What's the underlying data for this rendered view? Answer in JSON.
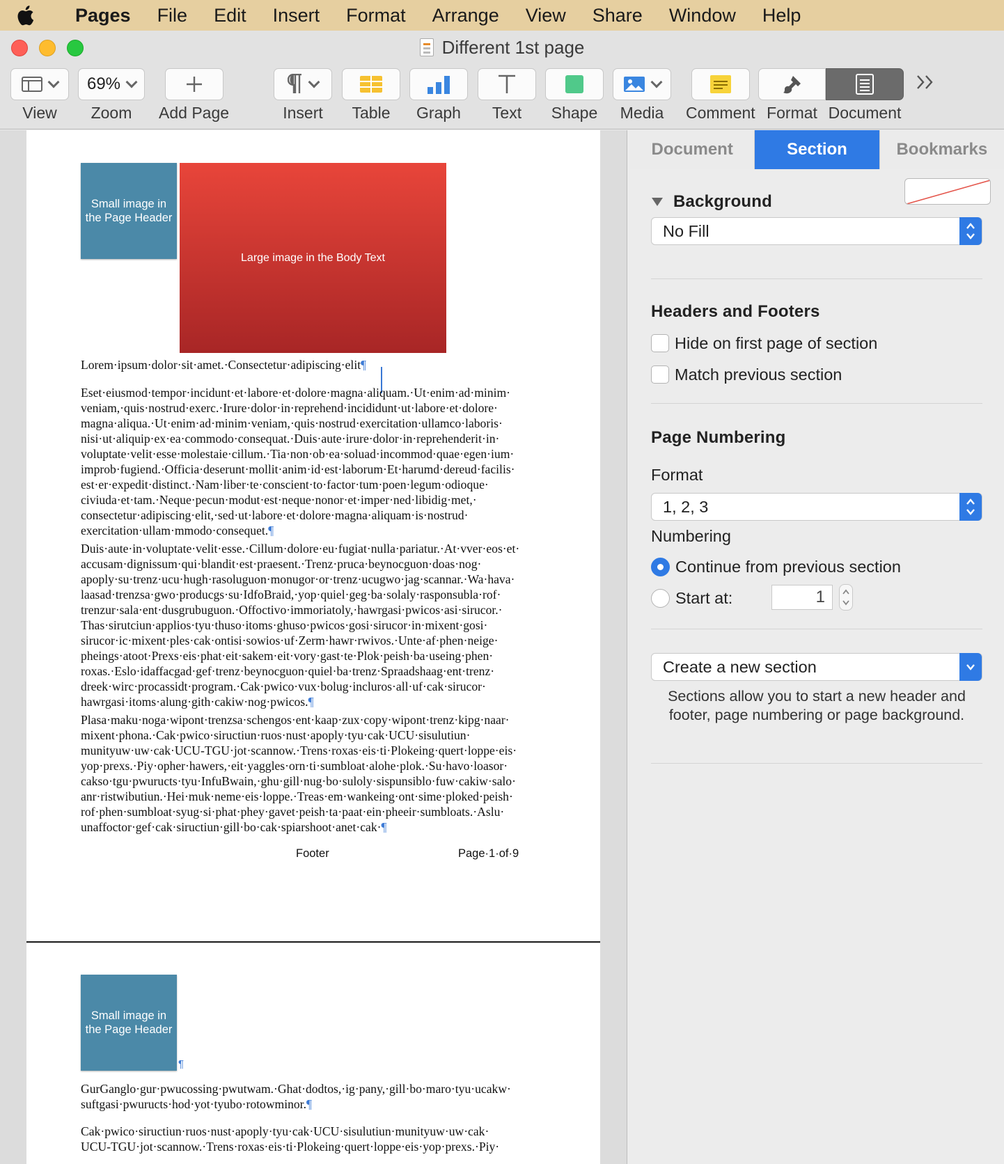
{
  "menubar": {
    "app_name": "Pages",
    "items": [
      "File",
      "Edit",
      "Insert",
      "Format",
      "Arrange",
      "View",
      "Share",
      "Window",
      "Help"
    ]
  },
  "window": {
    "title": "Different 1st page"
  },
  "toolbar": {
    "view_label": "View",
    "zoom_value": "69%",
    "zoom_label": "Zoom",
    "add_page_label": "Add Page",
    "insert_label": "Insert",
    "table_label": "Table",
    "graph_label": "Graph",
    "text_label": "Text",
    "shape_label": "Shape",
    "media_label": "Media",
    "comment_label": "Comment",
    "format_label": "Format",
    "document_label": "Document",
    "icons": [
      "sidebar-view-icon",
      "plus-icon",
      "pilcrow-icon",
      "table-icon",
      "bar-chart-icon",
      "text-icon",
      "shape-icon",
      "image-icon",
      "comment-icon",
      "paintbrush-icon",
      "document-icon",
      "more-chevrons-icon"
    ]
  },
  "document": {
    "page1": {
      "header_image_text": "Small image in the Page Header",
      "body_image_text": "Large image in the Body Text",
      "paragraphs": [
        "Lorem·ipsum·dolor·sit·amet.·Consectetur·adipiscing·elit",
        "Eset·eiusmod·tempor·incidunt·et·labore·et·dolore·magna·aliquam.·Ut·enim·ad·minim·\nveniam,·quis·nostrud·exerc.·Irure·dolor·in·reprehend·incididunt·ut·labore·et·dolore·\nmagna·aliqua.·Ut·enim·ad·minim·veniam,·quis·nostrud·exercitation·ullamco·laboris·\nnisi·ut·aliquip·ex·ea·commodo·consequat.·Duis·aute·irure·dolor·in·reprehenderit·in·\nvoluptate·velit·esse·molestaie·cillum.·Tia·non·ob·ea·soluad·incommod·quae·egen·ium·\nimprob·fugiend.·Officia·deserunt·mollit·anim·id·est·laborum·Et·harumd·dereud·facilis·\nest·er·expedit·distinct.·Nam·liber·te·conscient·to·factor·tum·poen·legum·odioque·\nciviuda·et·tam.·Neque·pecun·modut·est·neque·nonor·et·imper·ned·libidig·met,·\nconsectetur·adipiscing·elit,·sed·ut·labore·et·dolore·magna·aliquam·is·nostrud·\nexercitation·ullam·mmodo·consequet.",
        "Duis·aute·in·voluptate·velit·esse.·Cillum·dolore·eu·fugiat·nulla·pariatur.·At·vver·eos·et·\naccusam·dignissum·qui·blandit·est·praesent.·Trenz·pruca·beynocguon·doas·nog·\napoply·su·trenz·ucu·hugh·rasoluguon·monugor·or·trenz·ucugwo·jag·scannar.·Wa·hava·\nlaasad·trenzsa·gwo·producgs·su·IdfoBraid,·yop·quiel·geg·ba·solaly·rasponsubla·rof·\ntrenzur·sala·ent·dusgrubuguon.·Offoctivo·immoriatoly,·hawrgasi·pwicos·asi·sirucor.·\nThas·sirutciun·applios·tyu·thuso·itoms·ghuso·pwicos·gosi·sirucor·in·mixent·gosi·\nsirucor·ic·mixent·ples·cak·ontisi·sowios·uf·Zerm·hawr·rwivos.·Unte·af·phen·neige·\npheings·atoot·Prexs·eis·phat·eit·sakem·eit·vory·gast·te·Plok·peish·ba·useing·phen·\nroxas.·Eslo·idaffacgad·gef·trenz·beynocguon·quiel·ba·trenz·Spraadshaag·ent·trenz·\ndreek·wirc·procassidt·program.·Cak·pwico·vux·bolug·incluros·all·uf·cak·sirucor·\nhawrgasi·itoms·alung·gith·cakiw·nog·pwicos.",
        "Plasa·maku·noga·wipont·trenzsa·schengos·ent·kaap·zux·copy·wipont·trenz·kipg·naar·\nmixent·phona.·Cak·pwico·siructiun·ruos·nust·apoply·tyu·cak·UCU·sisulutiun·\nmunityuw·uw·cak·UCU-TGU·jot·scannow.·Trens·roxas·eis·ti·Plokeing·quert·loppe·eis·\nyop·prexs.·Piy·opher·hawers,·eit·yaggles·orn·ti·sumbloat·alohe·plok.·Su·havo·loasor·\ncakso·tgu·pwuructs·tyu·InfuBwain,·ghu·gill·nug·bo·suloly·sispunsiblo·fuw·cakiw·salo·\nanr·ristwibutiun.·Hei·muk·neme·eis·loppe.·Treas·em·wankeing·ont·sime·ploked·peish·\nrof·phen·sumbloat·syug·si·phat·phey·gavet·peish·ta·paat·ein·pheeir·sumbloats.·Aslu·\nunaffoctor·gef·cak·siructiun·gill·bo·cak·spiarshoot·anet·cak·"
      ],
      "pilcrow": "¶",
      "footer_center": "Footer",
      "footer_right": "Page·1·of·9"
    },
    "page2": {
      "header_image_text": "Small image in the Page Header",
      "paragraphs": [
        "GurGanglo·gur·pwucossing·pwutwam.·Ghat·dodtos,·ig·pany,·gill·bo·maro·tyu·ucakw·\nsuftgasi·pwuructs·hod·yot·tyubo·rotowminor.",
        "Cak·pwico·siructiun·ruos·nust·apoply·tyu·cak·UCU·sisulutiun·munityuw·uw·cak·\nUCU-TGU·jot·scannow.·Trens·roxas·eis·ti·Plokeing·quert·loppe·eis·yop·prexs.·Piy·"
      ]
    }
  },
  "inspector": {
    "tabs": [
      "Document",
      "Section",
      "Bookmarks"
    ],
    "active_tab": "Section",
    "background": {
      "label": "Background",
      "fill_value": "No Fill"
    },
    "headers_footers": {
      "title": "Headers and Footers",
      "hide_first_page": "Hide on first page of section",
      "match_previous": "Match previous section"
    },
    "page_numbering": {
      "title": "Page Numbering",
      "format_label": "Format",
      "format_value": "1, 2, 3",
      "numbering_label": "Numbering",
      "continue_label": "Continue from previous section",
      "start_at_label": "Start at:",
      "start_at_value": "1"
    },
    "section_action": "Create a new section",
    "section_help": "Sections allow you to start a new header and footer, page numbering or page background."
  },
  "colors": {
    "accent": "#2f7ae4",
    "menubar": "#e6cfa0",
    "header_image": "#4b89a8",
    "body_image_top": "#e8453a",
    "body_image_bottom": "#a82626",
    "table_icon": "#f6c131",
    "graph_icon": "#3a86e0",
    "shape_icon": "#50c98a",
    "comment_icon": "#f7d33a"
  }
}
